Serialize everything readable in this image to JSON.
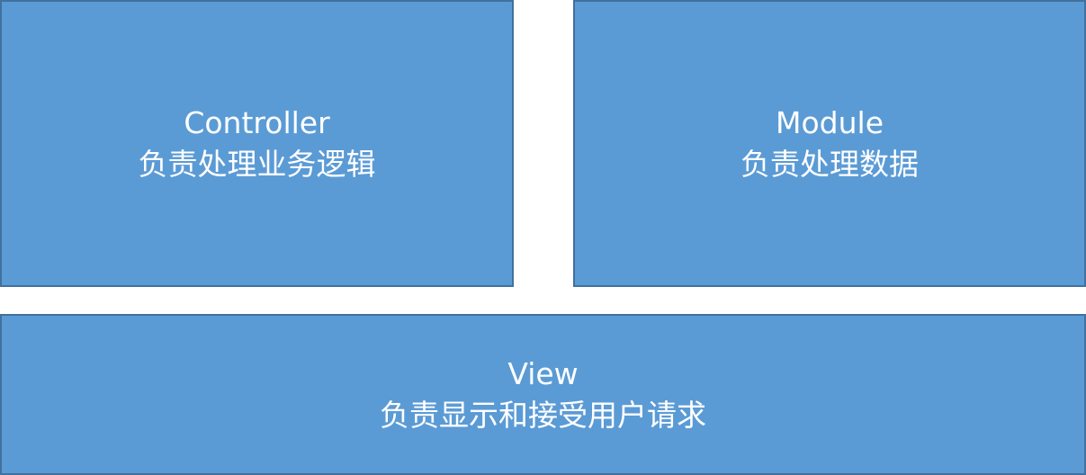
{
  "colors": {
    "box_fill": "#5b9bd5",
    "box_border": "#41719c",
    "text": "#ffffff",
    "background": "#ffffff"
  },
  "boxes": {
    "controller": {
      "title": "Controller",
      "description": "负责处理业务逻辑"
    },
    "module": {
      "title": "Module",
      "description": "负责处理数据"
    },
    "view": {
      "title": "View",
      "description": "负责显示和接受用户请求"
    }
  }
}
